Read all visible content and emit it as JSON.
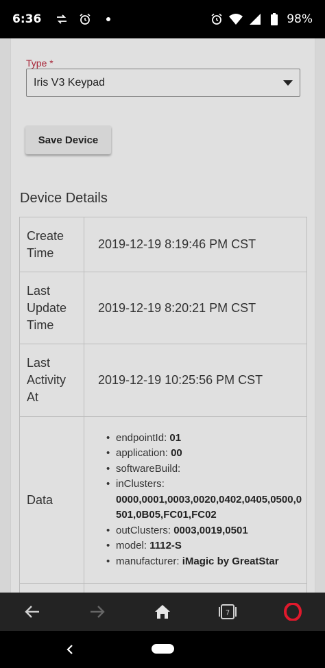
{
  "status_bar": {
    "time": "6:36",
    "battery": "98%"
  },
  "form": {
    "type_label": "Type *",
    "type_value": "Iris V3 Keypad",
    "save_label": "Save Device"
  },
  "details": {
    "title": "Device Details",
    "rows": [
      {
        "key": "Create Time",
        "value": "2019-12-19 8:19:46 PM CST"
      },
      {
        "key": "Last Update Time",
        "value": "2019-12-19 8:20:21 PM CST"
      },
      {
        "key": "Last Activity At",
        "value": "2019-12-19 10:25:56 PM CST"
      }
    ],
    "data_key": "Data",
    "data_items": [
      {
        "k": "endpointId",
        "v": "01"
      },
      {
        "k": "application",
        "v": "00"
      },
      {
        "k": "softwareBuild",
        "v": ""
      },
      {
        "k": "inClusters",
        "v": "0000,0001,0003,0020,0402,0405,0500,0501,0B05,FC01,FC02"
      },
      {
        "k": "outClusters",
        "v": "0003,0019,0501"
      },
      {
        "k": "model",
        "v": "1112-S"
      },
      {
        "k": "manufacturer",
        "v": "iMagic by GreatStar"
      }
    ]
  },
  "nav_bar": {
    "tab_count": "7",
    "accent_color": "#e0192c"
  }
}
